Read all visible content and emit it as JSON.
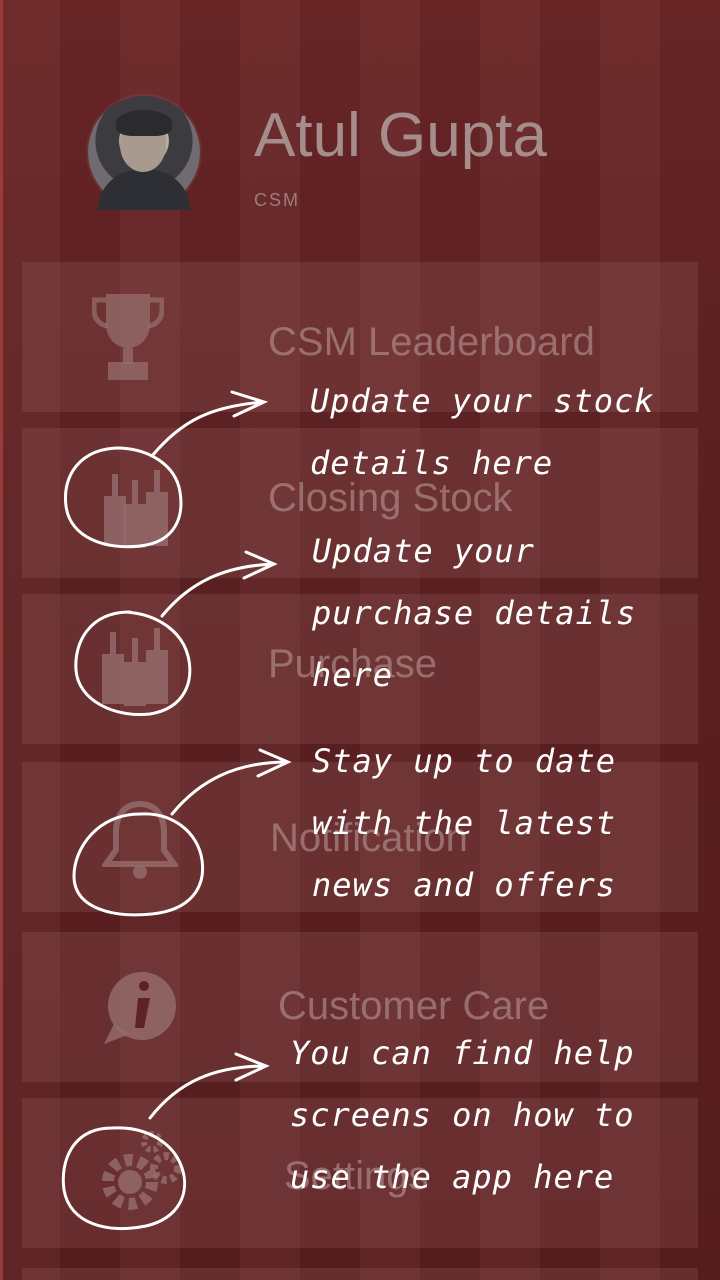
{
  "profile": {
    "name": "Atul Gupta",
    "role": "CSM"
  },
  "menu": [
    {
      "label": "CSM Leaderboard",
      "icon": "trophy-icon"
    },
    {
      "label": "Closing Stock",
      "icon": "bottles-icon"
    },
    {
      "label": "Purchase",
      "icon": "bottles-icon"
    },
    {
      "label": "Notification",
      "icon": "bell-icon"
    },
    {
      "label": "Customer Care",
      "icon": "info-chat-icon"
    },
    {
      "label": "Settings",
      "icon": "gears-icon"
    }
  ],
  "coach": {
    "stock": [
      "Update your stock",
      "details here"
    ],
    "purchase": [
      "Update your",
      "purchase details",
      "here"
    ],
    "notification": [
      "Stay up to date",
      "with the latest",
      "news and offers"
    ],
    "help": [
      "You can find help",
      "screens on how to",
      "use the app here"
    ]
  },
  "colors": {
    "background": "#5a1f20",
    "note_text": "#ffffff",
    "accent_edge": "#9a3a3a"
  }
}
